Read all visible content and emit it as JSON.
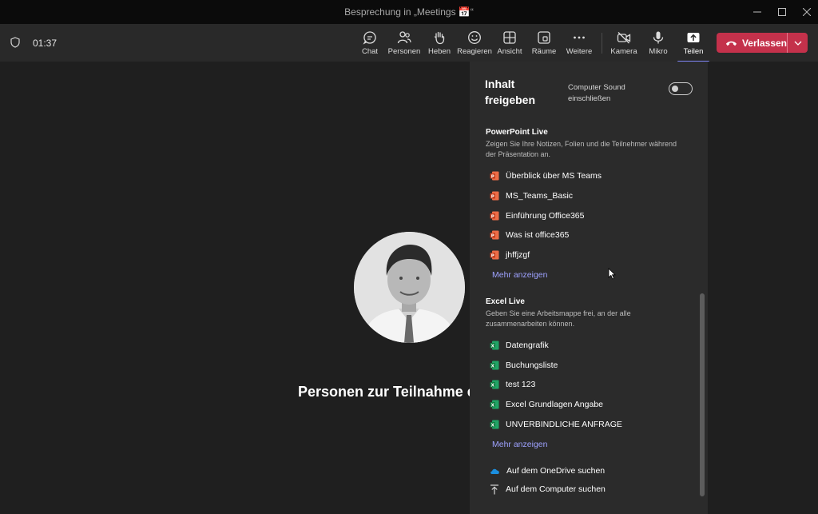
{
  "window": {
    "title": "Besprechung in „Meetings 📅“"
  },
  "meeting": {
    "timer": "01:37"
  },
  "toolbar": {
    "chat": "Chat",
    "people": "Personen",
    "raise": "Heben",
    "react": "Reagieren",
    "view": "Ansicht",
    "rooms": "Räume",
    "more": "Weitere",
    "camera": "Kamera",
    "mic": "Mikro",
    "share": "Teilen",
    "leave": "Verlassen"
  },
  "stage": {
    "invite_text": "Personen zur Teilnahme e"
  },
  "share_panel": {
    "title": "Inhalt freigeben",
    "sound_label": "Computer Sound einschließen",
    "powerpoint": {
      "title": "PowerPoint Live",
      "description": "Zeigen Sie Ihre Notizen, Folien und die Teilnehmer während der Präsentation an.",
      "items": [
        "Überblick über MS Teams",
        "MS_Teams_Basic",
        "Einführung Office365",
        "Was ist office365",
        "jhffjzgf"
      ],
      "more": "Mehr anzeigen"
    },
    "excel": {
      "title": "Excel Live",
      "description": "Geben Sie eine Arbeitsmappe frei, an der alle zusammenarbeiten können.",
      "items": [
        "Datengrafik",
        "Buchungsliste",
        "test 123",
        "Excel Grundlagen Angabe",
        "UNVERBINDLICHE ANFRAGE"
      ],
      "more": "Mehr anzeigen"
    },
    "onedrive": "Auf dem OneDrive suchen",
    "computer": "Auf dem Computer suchen"
  },
  "colors": {
    "accent": "#7f85f5",
    "leave": "#c4314b",
    "link": "#9ea2ff",
    "ppt": "#d24726",
    "excel": "#107c41"
  }
}
